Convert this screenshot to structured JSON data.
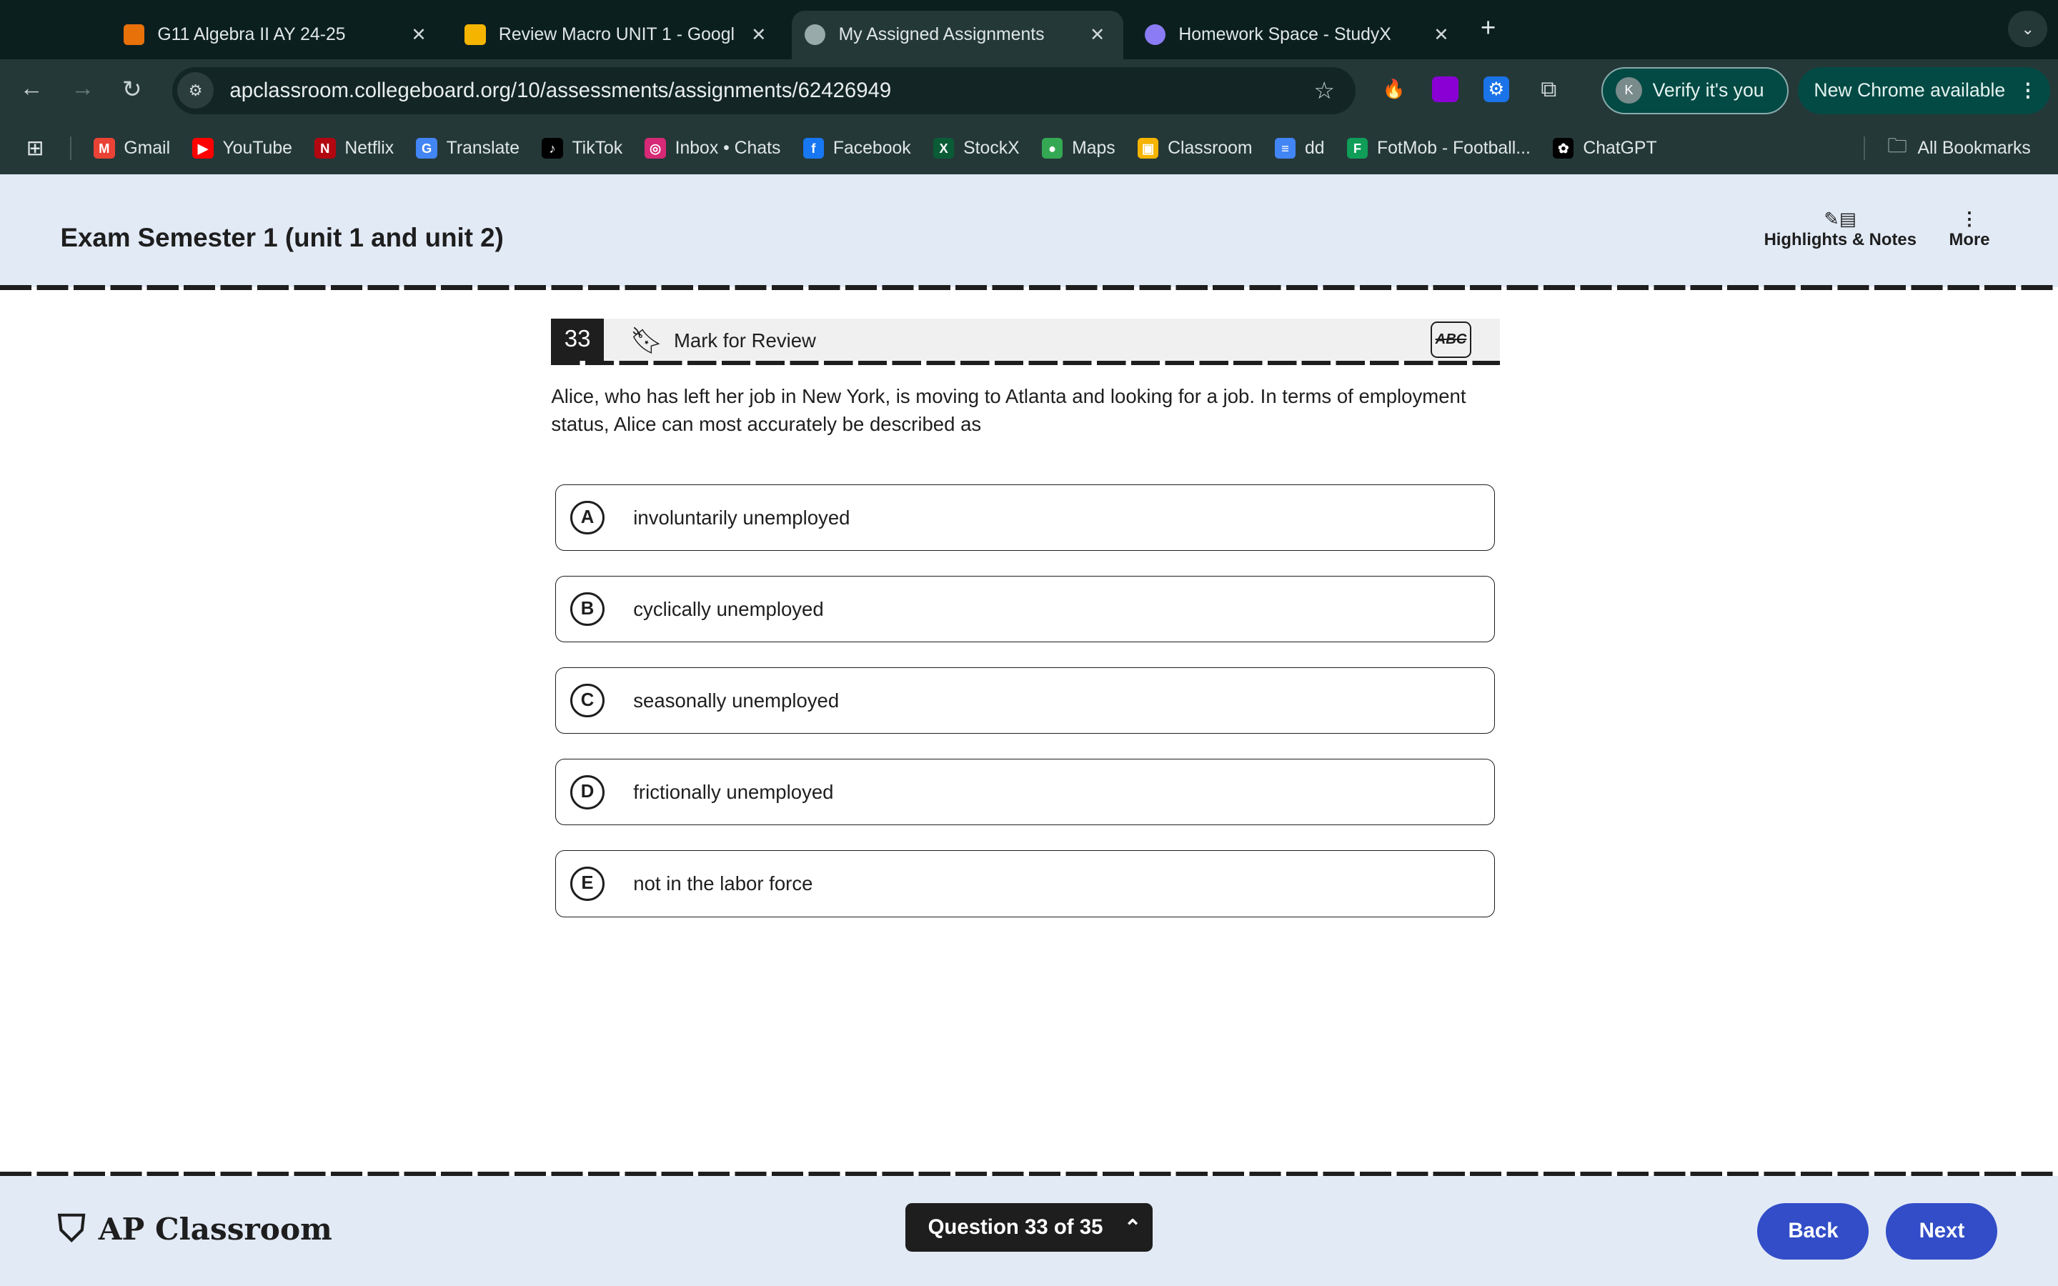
{
  "browser": {
    "tabs": [
      {
        "title": "G11 Algebra II AY 24-25",
        "color": "#e8710a"
      },
      {
        "title": "Review Macro UNIT 1 - Googl",
        "color": "#f4b400"
      },
      {
        "title": "My Assigned Assignments",
        "color": "#9aa",
        "active": true
      },
      {
        "title": "Homework Space - StudyX",
        "color": "#8b7cf6"
      }
    ],
    "url": "apclassroom.collegeboard.org/10/assessments/assignments/62426949",
    "verify_label": "Verify it's you",
    "verify_avatar": "K",
    "new_chrome_label": "New Chrome available",
    "bookmarks": [
      {
        "label": "Gmail",
        "color": "#ea4335",
        "glyph": "M"
      },
      {
        "label": "YouTube",
        "color": "#ff0000",
        "glyph": "▶"
      },
      {
        "label": "Netflix",
        "color": "#b20710",
        "glyph": "N"
      },
      {
        "label": "Translate",
        "color": "#4285f4",
        "glyph": "G"
      },
      {
        "label": "TikTok",
        "color": "#000000",
        "glyph": "♪"
      },
      {
        "label": "Inbox • Chats",
        "color": "#d62976",
        "glyph": "◎"
      },
      {
        "label": "Facebook",
        "color": "#1877f2",
        "glyph": "f"
      },
      {
        "label": "StockX",
        "color": "#0a5c36",
        "glyph": "X"
      },
      {
        "label": "Maps",
        "color": "#34a853",
        "glyph": "●"
      },
      {
        "label": "Classroom",
        "color": "#f4b400",
        "glyph": "▣"
      },
      {
        "label": "dd",
        "color": "#4285f4",
        "glyph": "≡"
      },
      {
        "label": "FotMob - Football...",
        "color": "#0f9d58",
        "glyph": "F"
      },
      {
        "label": "ChatGPT",
        "color": "#000000",
        "glyph": "✿"
      }
    ],
    "all_bookmarks": "All Bookmarks"
  },
  "header": {
    "title": "Exam Semester 1 (unit 1 and unit 2)",
    "highlights_label": "Highlights & Notes",
    "more_label": "More"
  },
  "question": {
    "number": "33",
    "mark_label": "Mark for Review",
    "abc_label": "ABC",
    "stem": "Alice, who has left her job in New York, is moving to Atlanta and looking for a job. In terms of employment status, Alice can most accurately be described as",
    "options": [
      {
        "letter": "A",
        "text": "involuntarily unemployed"
      },
      {
        "letter": "B",
        "text": "cyclically unemployed"
      },
      {
        "letter": "C",
        "text": "seasonally unemployed"
      },
      {
        "letter": "D",
        "text": "frictionally unemployed"
      },
      {
        "letter": "E",
        "text": "not in the labor force"
      }
    ]
  },
  "footer": {
    "logo": "AP Classroom",
    "progress": "Question 33 of 35",
    "back": "Back",
    "next": "Next",
    "accent": "#324dc7"
  }
}
